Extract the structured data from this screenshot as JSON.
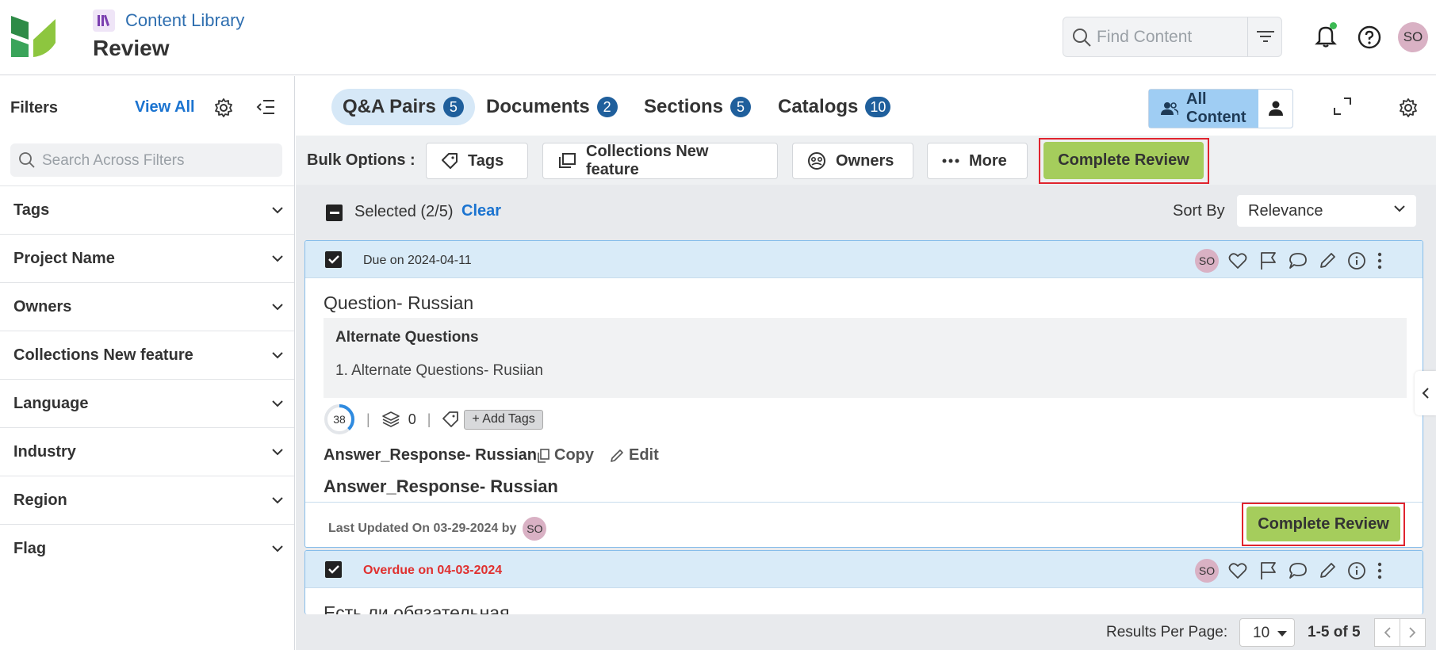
{
  "app": {
    "breadcrumb": "Content Library",
    "page_title": "Review"
  },
  "header": {
    "search_placeholder": "Find Content",
    "avatar_initials": "SO"
  },
  "sidebar": {
    "title": "Filters",
    "view_all": "View All",
    "search_placeholder": "Search Across Filters",
    "facets": [
      "Tags",
      "Project Name",
      "Owners",
      "Collections New feature",
      "Language",
      "Industry",
      "Region",
      "Flag"
    ]
  },
  "tabs": [
    {
      "label": "Q&A Pairs",
      "count": "5",
      "active": true
    },
    {
      "label": "Documents",
      "count": "2",
      "active": false
    },
    {
      "label": "Sections",
      "count": "5",
      "active": false
    },
    {
      "label": "Catalogs",
      "count": "10",
      "active": false
    }
  ],
  "view_toggle": {
    "all_content": "All Content"
  },
  "bulk": {
    "label": "Bulk Options :",
    "tags": "Tags",
    "collections": "Collections New feature",
    "owners": "Owners",
    "more": "More",
    "complete_review": "Complete Review"
  },
  "selection": {
    "text": "Selected (2/5)",
    "clear": "Clear",
    "sort_label": "Sort By",
    "sort_value": "Relevance"
  },
  "cards": [
    {
      "due": "Due on 2024-04-11",
      "owner_initials": "SO",
      "title": "Question- Russian",
      "alt_heading": "Alternate Questions",
      "alt_item": "1. Alternate Questions- Rusiian",
      "score": "38",
      "score_fraction": 0.38,
      "collections_count": "0",
      "add_tags": "+ Add Tags",
      "answer_label": "Answer_Response- Russian",
      "copy": "Copy",
      "edit": "Edit",
      "answer_text": "Answer_Response- Russian",
      "last_updated": "Last Updated On 03-29-2024 by",
      "updated_by": "SO",
      "complete_review": "Complete Review"
    },
    {
      "due": "Overdue on 04-03-2024",
      "owner_initials": "SO",
      "title": "Есть ли обязательная"
    }
  ],
  "pager": {
    "results_per_page_label": "Results Per Page:",
    "per_page": "10",
    "range": "1-5 of 5"
  },
  "colors": {
    "accent": "#1a73d0",
    "complete_button": "#a5cd5c",
    "badge": "#1f5f9c",
    "overdue": "#e0302f",
    "highlight": "#e0242e"
  }
}
